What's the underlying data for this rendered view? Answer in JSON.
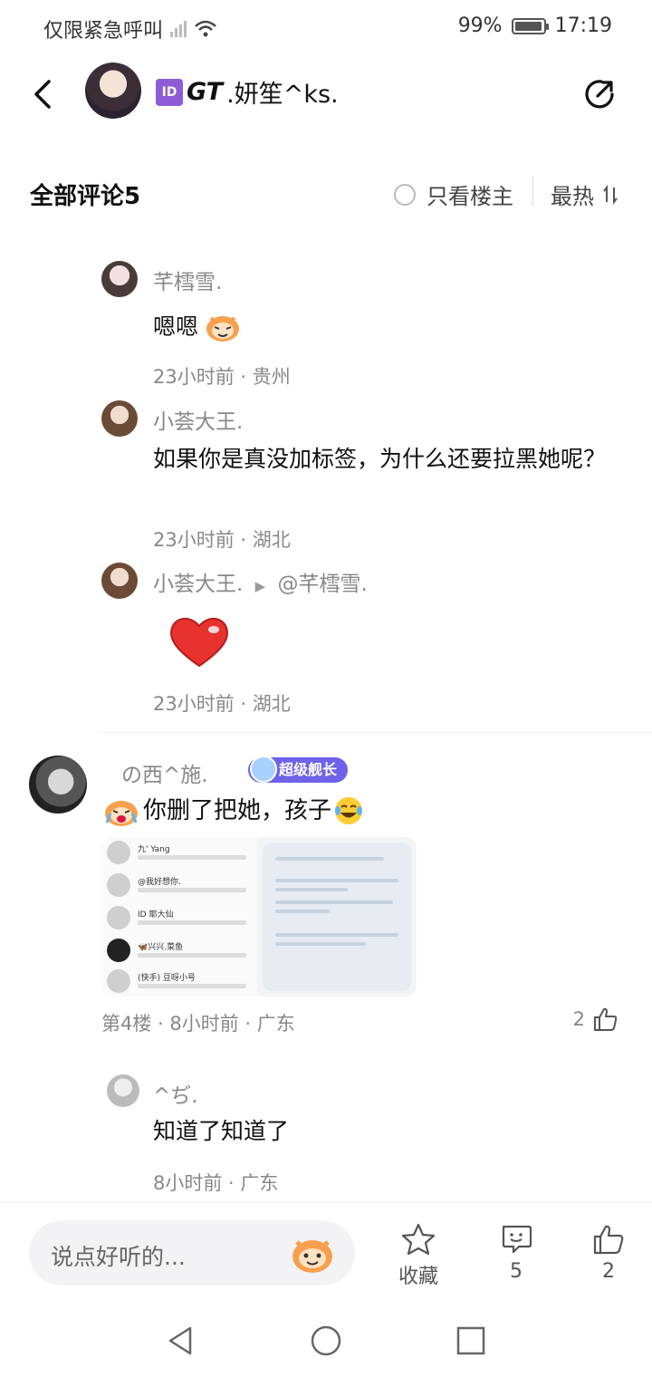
{
  "status_bar": {
    "carrier": "仅限紧急呼叫",
    "battery": "99%",
    "battery_level": 0.99,
    "time": "17:19"
  },
  "header": {
    "badge": "ID",
    "name_prefix": "GT",
    "name_rest": ".妍笙^ks.",
    "back_icon": "back-arrow-icon",
    "share_icon": "share-icon"
  },
  "comment_bar": {
    "title": "全部评论5",
    "only_op_label": "只看楼主",
    "sort_label": "最热"
  },
  "replies": [
    {
      "name": "芊樰雪.",
      "text": "嗯嗯",
      "meta": "23小时前 · 贵州",
      "emoji": "monkey-emoji"
    },
    {
      "name": "小荟大王.",
      "text": "如果你是真没加标签，为什么还要拉黑她呢？",
      "meta": "23小时前 · 湖北"
    },
    {
      "name": "小荟大王.",
      "reply_to": "@芊樰雪.",
      "meta": "23小时前 · 湖北",
      "emoji": "heart-sticker"
    }
  ],
  "floor": {
    "name": "の西^施.",
    "badge": "超级舰长",
    "text": "你删了把她，孩子",
    "meta": "第4楼 · 8小时前 · 广东",
    "likes": "2",
    "thumbnail_rows": [
      "九' Yang",
      "@我好想你.",
      "ID 耶大仙",
      "🦋兴兴.菜鱼",
      "(快手) 豆呀小号"
    ]
  },
  "sub_reply": {
    "name": "^ぢ.",
    "text": "知道了知道了",
    "meta": "8小时前 · 广东"
  },
  "bottom_bar": {
    "placeholder": "说点好听的...",
    "favorite_label": "收藏",
    "comment_count": "5",
    "like_count": "2"
  }
}
